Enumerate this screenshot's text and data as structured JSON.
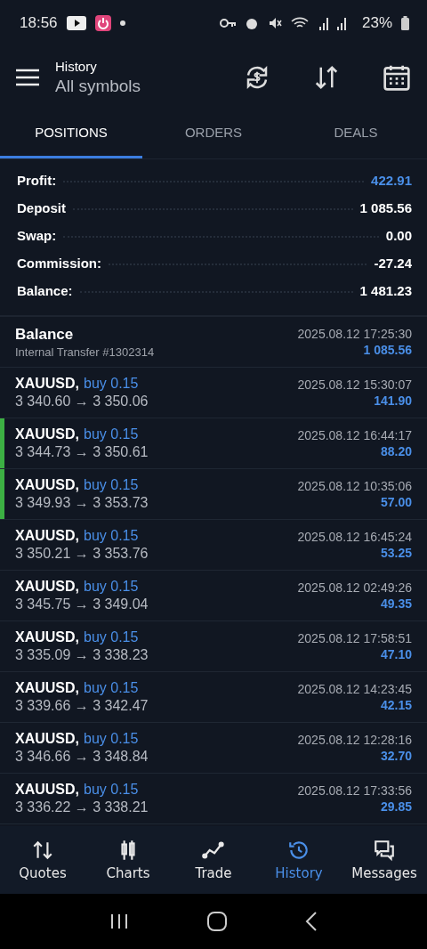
{
  "status_bar": {
    "time": "18:56",
    "battery": "23%"
  },
  "header": {
    "title": "History",
    "subtitle": "All symbols"
  },
  "tabs": [
    {
      "label": "POSITIONS",
      "selected": true
    },
    {
      "label": "ORDERS",
      "selected": false
    },
    {
      "label": "DEALS",
      "selected": false
    }
  ],
  "summary": [
    {
      "label": "Profit:",
      "value": "422.91",
      "highlight": true
    },
    {
      "label": "Deposit",
      "value": "1 085.56",
      "highlight": false
    },
    {
      "label": "Swap:",
      "value": "0.00",
      "highlight": false
    },
    {
      "label": "Commission:",
      "value": "-27.24",
      "highlight": false
    },
    {
      "label": "Balance:",
      "value": "1 481.23",
      "highlight": false
    }
  ],
  "balance_entry": {
    "title": "Balance",
    "comment": "Internal Transfer #1302314",
    "time": "2025.08.12 17:25:30",
    "amount": "1 085.56"
  },
  "deals": [
    {
      "symbol": "XAUUSD,",
      "side": "buy 0.15",
      "prices": "3 340.60 → 3 350.06",
      "time": "2025.08.12 15:30:07",
      "profit": "141.90",
      "marked": false
    },
    {
      "symbol": "XAUUSD,",
      "side": "buy 0.15",
      "prices": "3 344.73 → 3 350.61",
      "time": "2025.08.12 16:44:17",
      "profit": "88.20",
      "marked": true
    },
    {
      "symbol": "XAUUSD,",
      "side": "buy 0.15",
      "prices": "3 349.93 → 3 353.73",
      "time": "2025.08.12 10:35:06",
      "profit": "57.00",
      "marked": true
    },
    {
      "symbol": "XAUUSD,",
      "side": "buy 0.15",
      "prices": "3 350.21 → 3 353.76",
      "time": "2025.08.12 16:45:24",
      "profit": "53.25",
      "marked": false
    },
    {
      "symbol": "XAUUSD,",
      "side": "buy 0.15",
      "prices": "3 345.75 → 3 349.04",
      "time": "2025.08.12 02:49:26",
      "profit": "49.35",
      "marked": false
    },
    {
      "symbol": "XAUUSD,",
      "side": "buy 0.15",
      "prices": "3 335.09 → 3 338.23",
      "time": "2025.08.12 17:58:51",
      "profit": "47.10",
      "marked": false
    },
    {
      "symbol": "XAUUSD,",
      "side": "buy 0.15",
      "prices": "3 339.66 → 3 342.47",
      "time": "2025.08.12 14:23:45",
      "profit": "42.15",
      "marked": false
    },
    {
      "symbol": "XAUUSD,",
      "side": "buy 0.15",
      "prices": "3 346.66 → 3 348.84",
      "time": "2025.08.12 12:28:16",
      "profit": "32.70",
      "marked": false
    },
    {
      "symbol": "XAUUSD,",
      "side": "buy 0.15",
      "prices": "3 336.22 → 3 338.21",
      "time": "2025.08.12 17:33:56",
      "profit": "29.85",
      "marked": false
    }
  ],
  "bottom_nav": [
    {
      "label": "Quotes",
      "kind": "quotes",
      "selected": false
    },
    {
      "label": "Charts",
      "kind": "charts",
      "selected": false
    },
    {
      "label": "Trade",
      "kind": "trade",
      "selected": false
    },
    {
      "label": "History",
      "kind": "history",
      "selected": true
    },
    {
      "label": "Messages",
      "kind": "messages",
      "selected": false
    }
  ]
}
